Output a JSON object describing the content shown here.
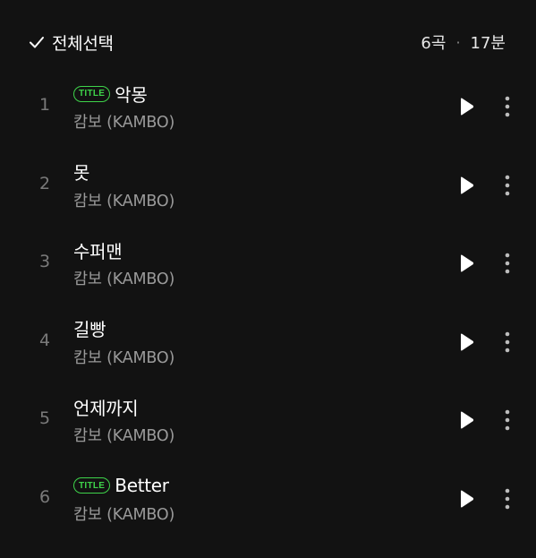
{
  "header": {
    "select_all_label": "전체선택",
    "check_icon": "check-icon",
    "track_count": "6곡",
    "separator": "·",
    "total_duration": "17분"
  },
  "colors": {
    "background": "#121212",
    "accent_green": "#3ed34a",
    "primary_text": "#ffffff",
    "secondary_text": "#9a9a9a",
    "track_number": "#7a7a7a"
  },
  "tracks": [
    {
      "number": "1",
      "title": "악몽",
      "artist": "캄보 (KAMBO)",
      "badge": "TITLE"
    },
    {
      "number": "2",
      "title": "못",
      "artist": "캄보 (KAMBO)",
      "badge": ""
    },
    {
      "number": "3",
      "title": "수퍼맨",
      "artist": "캄보 (KAMBO)",
      "badge": ""
    },
    {
      "number": "4",
      "title": "길빵",
      "artist": "캄보 (KAMBO)",
      "badge": ""
    },
    {
      "number": "5",
      "title": "언제까지",
      "artist": "캄보 (KAMBO)",
      "badge": ""
    },
    {
      "number": "6",
      "title": "Better",
      "artist": "캄보 (KAMBO)",
      "badge": "TITLE"
    }
  ],
  "icons": {
    "play": "play-icon",
    "more": "more-vertical-icon"
  }
}
